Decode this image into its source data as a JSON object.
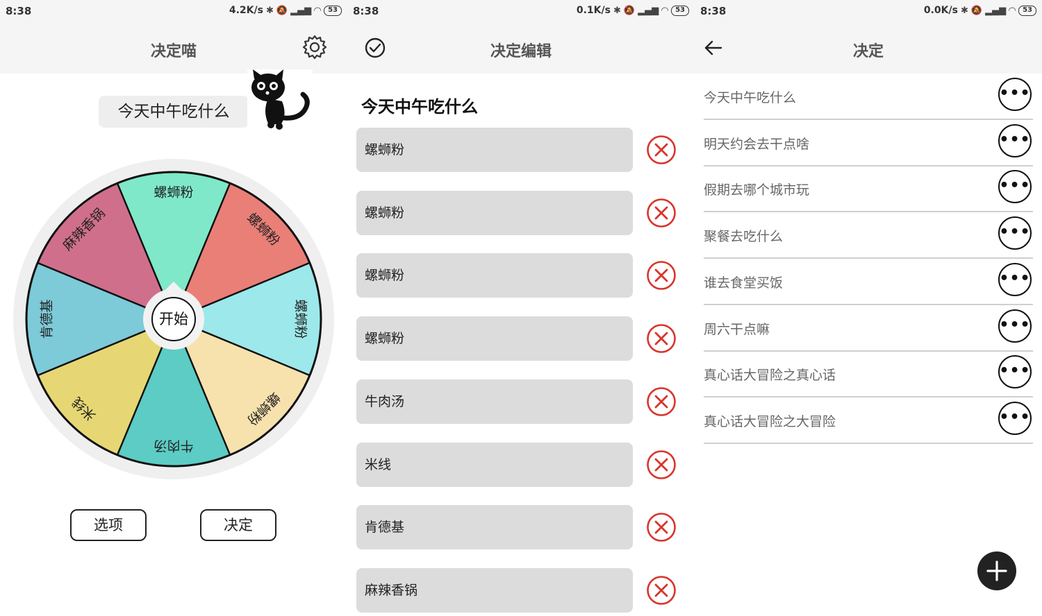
{
  "status": {
    "time": "8:38",
    "speeds": [
      "4.2K/s",
      "0.1K/s",
      "0.0K/s"
    ],
    "battery": "53"
  },
  "panel_main": {
    "title": "决定喵",
    "question": "今天中午吃什么",
    "start_label": "开始",
    "wheel_segments": [
      {
        "label": "螺蛳粉",
        "color": "#7fe8c8"
      },
      {
        "label": "螺蛳粉",
        "color": "#ea7f78"
      },
      {
        "label": "螺蛳粉",
        "color": "#9de8ea"
      },
      {
        "label": "螺蛳粉",
        "color": "#f7e2ae"
      },
      {
        "label": "牛肉汤",
        "color": "#5cccc4"
      },
      {
        "label": "米线",
        "color": "#e6d774"
      },
      {
        "label": "肯德基",
        "color": "#7dcad8"
      },
      {
        "label": "麻辣香锅",
        "color": "#d06f8c"
      }
    ],
    "options_button": "选项",
    "decide_button": "决定"
  },
  "panel_edit": {
    "title": "决定编辑",
    "heading": "今天中午吃什么",
    "options": [
      "螺蛳粉",
      "螺蛳粉",
      "螺蛳粉",
      "螺蛳粉",
      "牛肉汤",
      "米线",
      "肯德基",
      "麻辣香锅"
    ]
  },
  "panel_list": {
    "title": "决定",
    "items": [
      "今天中午吃什么",
      "明天约会去干点啥",
      "假期去哪个城市玩",
      "聚餐去吃什么",
      "谁去食堂买饭",
      "周六干点嘛",
      "真心话大冒险之真心话",
      "真心话大冒险之大冒险"
    ]
  },
  "colors": {
    "delete_red": "#d9342b",
    "accent_dark": "#222222",
    "bar_bg": "#f5f5f5"
  },
  "icons": [
    "gear-icon",
    "check-circle-icon",
    "back-arrow-icon",
    "delete-x-icon",
    "more-dots-icon",
    "plus-icon",
    "cat-mascot"
  ]
}
